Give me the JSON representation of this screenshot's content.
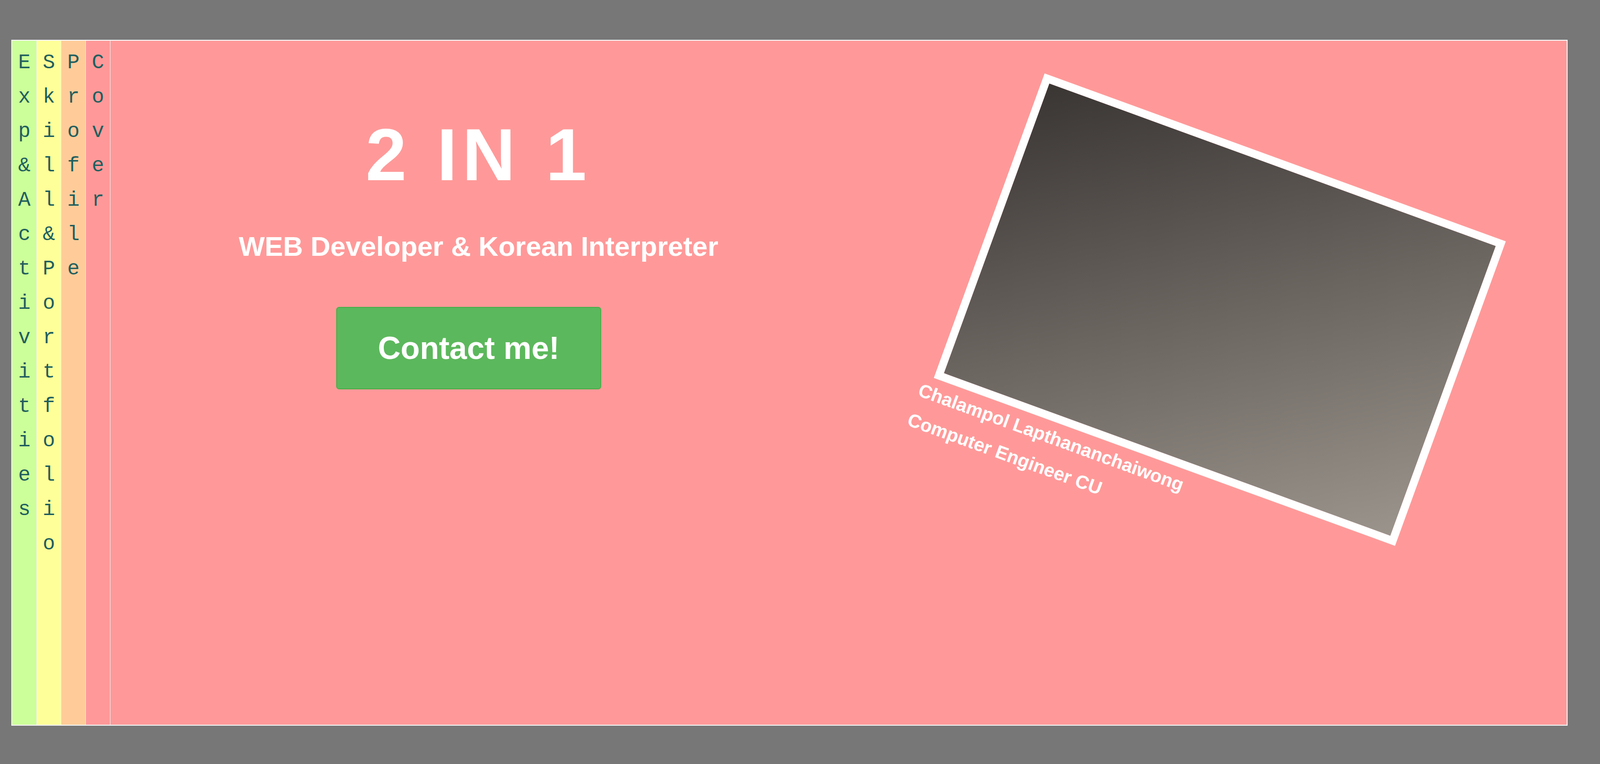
{
  "tabs": [
    {
      "label": "Exp&Activities",
      "selected": false,
      "color": "#ccff99"
    },
    {
      "label": "Skill&Portfolio",
      "selected": false,
      "color": "#ffff99"
    },
    {
      "label": "Profile",
      "selected": false,
      "color": "#ffcc99"
    },
    {
      "label": "Cover",
      "selected": true,
      "color": "#ff9999"
    }
  ],
  "cover": {
    "title": "2 IN 1",
    "subtitle": "WEB Developer & Korean Interpreter",
    "button": "Contact me!",
    "caption": [
      "Chalampol Lapthananchaiwong",
      "Computer Engineer CU"
    ]
  }
}
